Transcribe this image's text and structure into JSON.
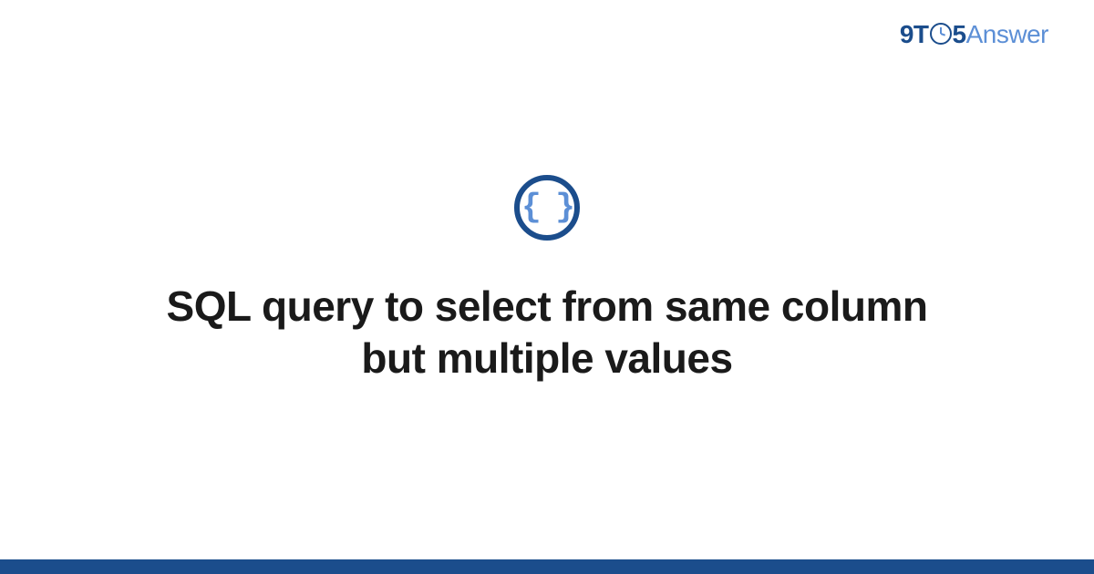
{
  "brand": {
    "part1": "9T",
    "part2": "5",
    "part3": "Answer"
  },
  "icon": {
    "glyph": "{ }",
    "name": "code-braces-icon"
  },
  "main": {
    "title": "SQL query to select from same column but multiple values"
  },
  "colors": {
    "primary": "#1b4d8c",
    "accent": "#5c8fd6"
  }
}
